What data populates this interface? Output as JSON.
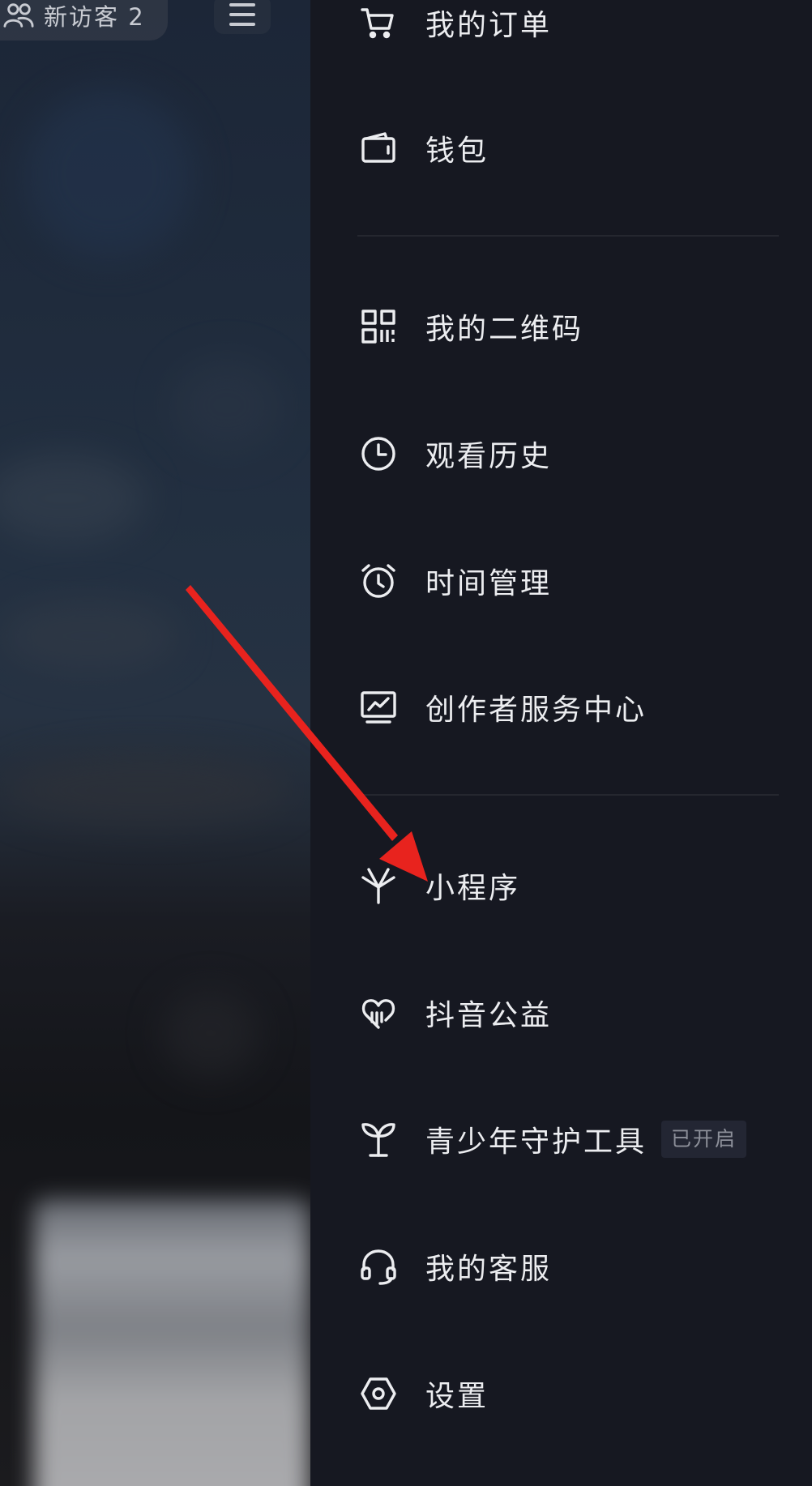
{
  "top_bar": {
    "visitor_label": "新访客 2",
    "menu_icon": "hamburger-icon"
  },
  "drawer": {
    "items": [
      {
        "label": "我的订单",
        "icon": "cart-icon"
      },
      {
        "label": "钱包",
        "icon": "wallet-icon"
      },
      {
        "label": "我的二维码",
        "icon": "qrcode-icon"
      },
      {
        "label": "观看历史",
        "icon": "clock-icon"
      },
      {
        "label": "时间管理",
        "icon": "alarm-icon"
      },
      {
        "label": "创作者服务中心",
        "icon": "creator-chart-icon"
      },
      {
        "label": "小程序",
        "icon": "mini-program-icon"
      },
      {
        "label": "抖音公益",
        "icon": "charity-heart-icon"
      },
      {
        "label": "青少年守护工具",
        "icon": "sprout-icon",
        "badge": "已开启"
      },
      {
        "label": "我的客服",
        "icon": "headset-icon"
      },
      {
        "label": "设置",
        "icon": "settings-hexagon-icon"
      }
    ]
  },
  "annotation": {
    "arrow_color": "#e8231e",
    "target": "小程序"
  },
  "colors": {
    "drawer_background": "#161821",
    "text": "#ecedf0",
    "badge_text": "#8d909a",
    "divider": "#25272f"
  }
}
